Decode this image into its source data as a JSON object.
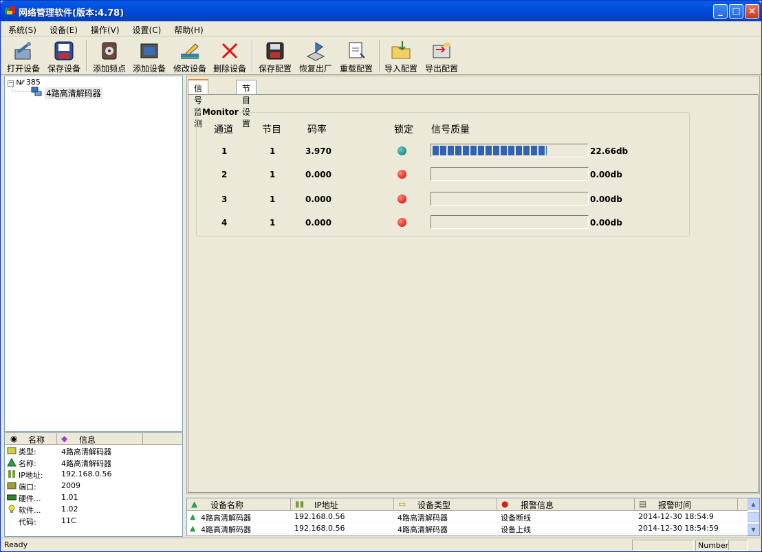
{
  "window": {
    "title": "网络管理软件(版本:4.78)",
    "min_label": "_",
    "max_label": "□",
    "close_label": "×"
  },
  "menu": [
    {
      "label": "系统(S)"
    },
    {
      "label": "设备(E)"
    },
    {
      "label": "操作(V)"
    },
    {
      "label": "设置(C)"
    },
    {
      "label": "帮助(H)"
    }
  ],
  "toolbar": [
    {
      "label": "打开设备",
      "icon": "open-device-icon"
    },
    {
      "label": "保存设备",
      "icon": "save-device-icon"
    },
    {
      "label": "添加频点",
      "icon": "add-frequency-icon"
    },
    {
      "label": "添加设备",
      "icon": "add-device-icon"
    },
    {
      "label": "修改设备",
      "icon": "edit-device-icon"
    },
    {
      "label": "删除设备",
      "icon": "delete-device-icon"
    },
    {
      "label": "保存配置",
      "icon": "save-config-icon"
    },
    {
      "label": "恢复出厂",
      "icon": "factory-reset-icon"
    },
    {
      "label": "重载配置",
      "icon": "reload-config-icon"
    },
    {
      "label": "导入配置",
      "icon": "import-config-icon"
    },
    {
      "label": "导出配置",
      "icon": "export-config-icon"
    }
  ],
  "tree": {
    "root_label": "385",
    "child_label": "4路高清解码器"
  },
  "info": {
    "header_name": "名称",
    "header_info": "信息",
    "rows": [
      {
        "key": "类型:",
        "value": "4路高清解码器"
      },
      {
        "key": "名称:",
        "value": "4路高清解码器"
      },
      {
        "key": "IP地址:",
        "value": "192.168.0.56"
      },
      {
        "key": "端口:",
        "value": "2009"
      },
      {
        "key": "硬件...",
        "value": "1.01"
      },
      {
        "key": "软件...",
        "value": "1.02"
      },
      {
        "key": "代码:",
        "value": "11C"
      }
    ]
  },
  "tabs": [
    {
      "label": "信号监测",
      "active": true
    },
    {
      "label": "节目设置",
      "active": false
    }
  ],
  "monitor": {
    "legend": "Monitor",
    "headers": {
      "channel": "通道",
      "program": "节目",
      "bitrate": "码率",
      "lock": "锁定",
      "quality": "信号质量"
    },
    "rows": [
      {
        "channel": "1",
        "program": "1",
        "bitrate": "3.970",
        "locked": true,
        "quality_fraction": 0.74,
        "quality_text": "22.66db"
      },
      {
        "channel": "2",
        "program": "1",
        "bitrate": "0.000",
        "locked": false,
        "quality_fraction": 0,
        "quality_text": "0.00db"
      },
      {
        "channel": "3",
        "program": "1",
        "bitrate": "0.000",
        "locked": false,
        "quality_fraction": 0,
        "quality_text": "0.00db"
      },
      {
        "channel": "4",
        "program": "1",
        "bitrate": "0.000",
        "locked": false,
        "quality_fraction": 0,
        "quality_text": "0.00db"
      }
    ]
  },
  "alarms": {
    "headers": {
      "name": "设备名称",
      "ip": "IP地址",
      "type": "设备类型",
      "info": "报警信息",
      "time": "报警时间"
    },
    "rows": [
      {
        "name": "4路高清解码器",
        "ip": "192.168.0.56",
        "type": "4路高清解码器",
        "info": "设备断线",
        "time": "2014-12-30  18:54:9"
      },
      {
        "name": "4路高清解码器",
        "ip": "192.168.0.56",
        "type": "4路高清解码器",
        "info": "设备上线",
        "time": "2014-12-30  18:54:59"
      }
    ]
  },
  "status": {
    "ready": "Ready",
    "number": "Number"
  },
  "colors": {
    "title_blue": "#0054e3",
    "lock_ok": "#077070",
    "lock_bad": "#d00000",
    "bar_fill": "#3162b3"
  }
}
